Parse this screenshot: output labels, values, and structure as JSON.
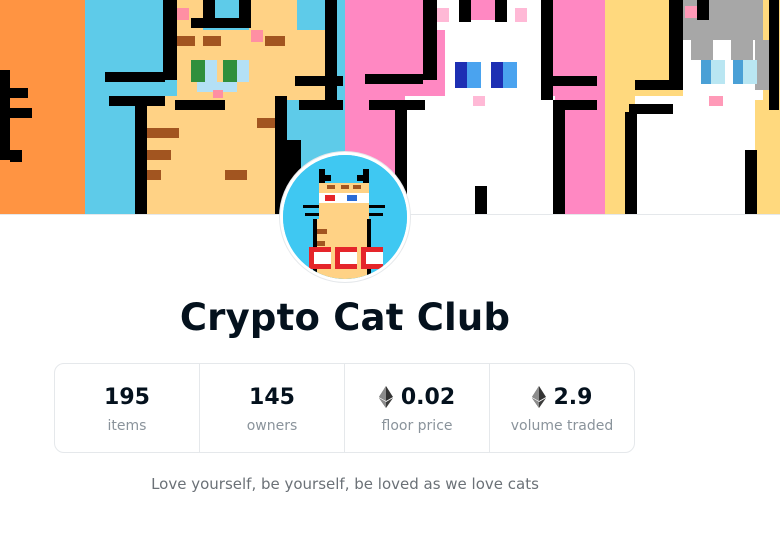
{
  "banner": {
    "panels": [
      {
        "name": "cat-panel-orange",
        "background": "#ff9442"
      },
      {
        "name": "cat-panel-blue",
        "background": "#5ecbe9"
      },
      {
        "name": "cat-panel-pink",
        "background": "#ff88c2"
      },
      {
        "name": "cat-panel-yellow",
        "background": "#ffd97e"
      }
    ]
  },
  "avatar": {
    "icon": "crypto-cat-avatar",
    "background": "#3fc8f2",
    "accent": "#e5252a"
  },
  "collection": {
    "title": "Crypto Cat Club",
    "description": "Love yourself, be yourself, be loved as we love cats"
  },
  "stats": [
    {
      "value": "195",
      "label": "items",
      "eth": false
    },
    {
      "value": "145",
      "label": "owners",
      "eth": false
    },
    {
      "value": "0.02",
      "label": "floor price",
      "eth": true
    },
    {
      "value": "2.9",
      "label": "volume traded",
      "eth": true
    }
  ],
  "colors": {
    "text": "#04111d",
    "muted": "#8a939b",
    "border": "#e5e8eb"
  }
}
